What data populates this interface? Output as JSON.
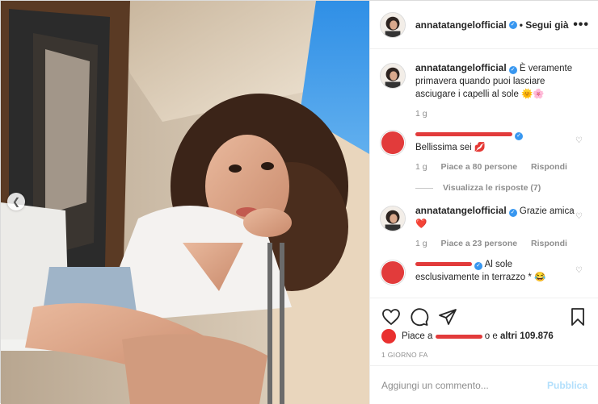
{
  "post": {
    "username": "annatatangelofficial",
    "follow_label": "• Segui già",
    "more_label": "•••"
  },
  "caption": {
    "username": "annatatangelofficial",
    "text": "È veramente primavera quando puoi lasciare asciugare i capelli al sole 🌞🌸",
    "time": "1 g"
  },
  "comments": [
    {
      "username": "",
      "text": "Bellissima sei 💋",
      "time": "1 g",
      "likes": "Piace a 80 persone",
      "reply": "Rispondi",
      "view_replies": "Visualizza le risposte (7)"
    },
    {
      "username": "annatatangelofficial",
      "text": "Grazie amica ❤️",
      "time": "1 g",
      "likes": "Piace a 23 persone",
      "reply": "Rispondi"
    },
    {
      "username": "",
      "text": "Al sole esclusivamente in terrazzo * 😂",
      "time": "",
      "likes": "",
      "reply": ""
    }
  ],
  "likes_line": {
    "prefix": "Piace a",
    "mid": "o e",
    "suffix": "altri 109.876"
  },
  "date": "1 GIORNO FA",
  "add_comment": {
    "placeholder": "Aggiungi un commento...",
    "publish_label": "Pubblica"
  },
  "colors": {
    "verified": "#3897f0",
    "redaction": "#e23b3b",
    "publish_disabled": "#b2dffc"
  }
}
